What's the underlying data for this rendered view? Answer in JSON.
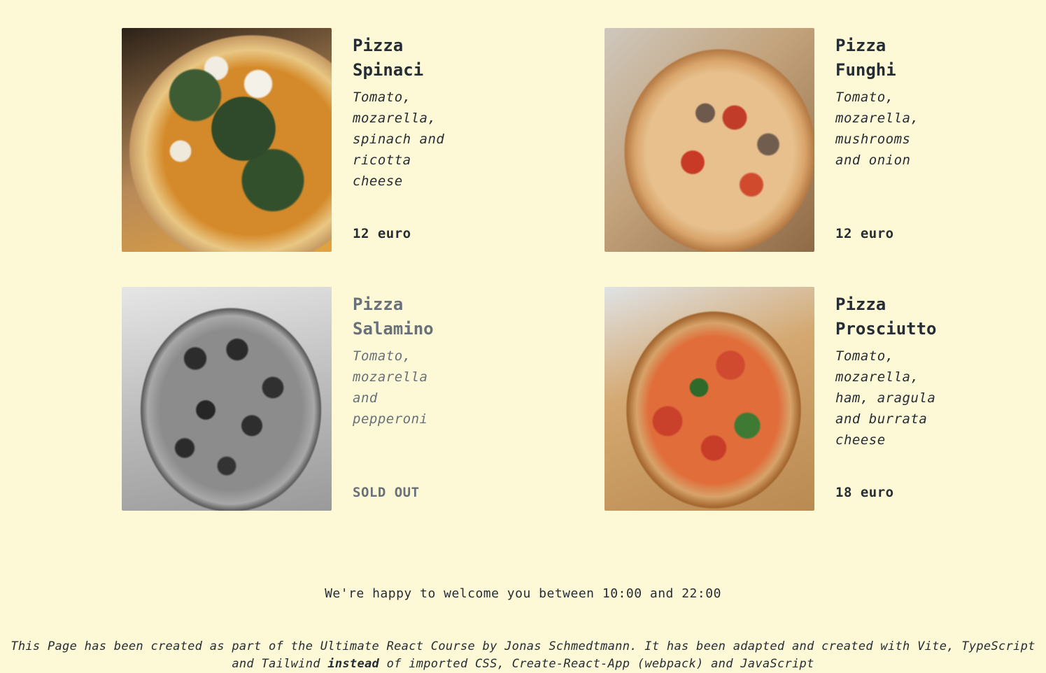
{
  "menu": {
    "pizzas": [
      {
        "name": "Pizza Spinaci",
        "ingredients": "Tomato, mozarella, spinach and ricotta cheese",
        "price_label": "12 euro",
        "sold_out": false,
        "photo_icon": "pizza-spinaci-photo"
      },
      {
        "name": "Pizza Funghi",
        "ingredients": "Tomato, mozarella, mushrooms and onion",
        "price_label": "12 euro",
        "sold_out": false,
        "photo_icon": "pizza-funghi-photo"
      },
      {
        "name": "Pizza Salamino",
        "ingredients": "Tomato, mozarella and pepperoni",
        "price_label": "SOLD OUT",
        "sold_out": true,
        "photo_icon": "pizza-salamino-photo"
      },
      {
        "name": "Pizza Prosciutto",
        "ingredients": "Tomato, mozarella, ham, aragula and burrata cheese",
        "price_label": "18 euro",
        "sold_out": false,
        "photo_icon": "pizza-prosciutto-photo"
      }
    ]
  },
  "footer": {
    "welcome": "We're happy to welcome you between 10:00 and 22:00",
    "credits_before": "This Page has been created as part of the Ultimate React Course by Jonas Schmedtmann. It has been adapted and created with Vite, TypeScript and Tailwind ",
    "credits_emphasis": "instead",
    "credits_after": " of imported CSS, Create-React-App (webpack) and JavaScript"
  },
  "colors": {
    "background": "#fdf9d7",
    "text": "#262c33",
    "sold_out_text": "#68707a"
  }
}
